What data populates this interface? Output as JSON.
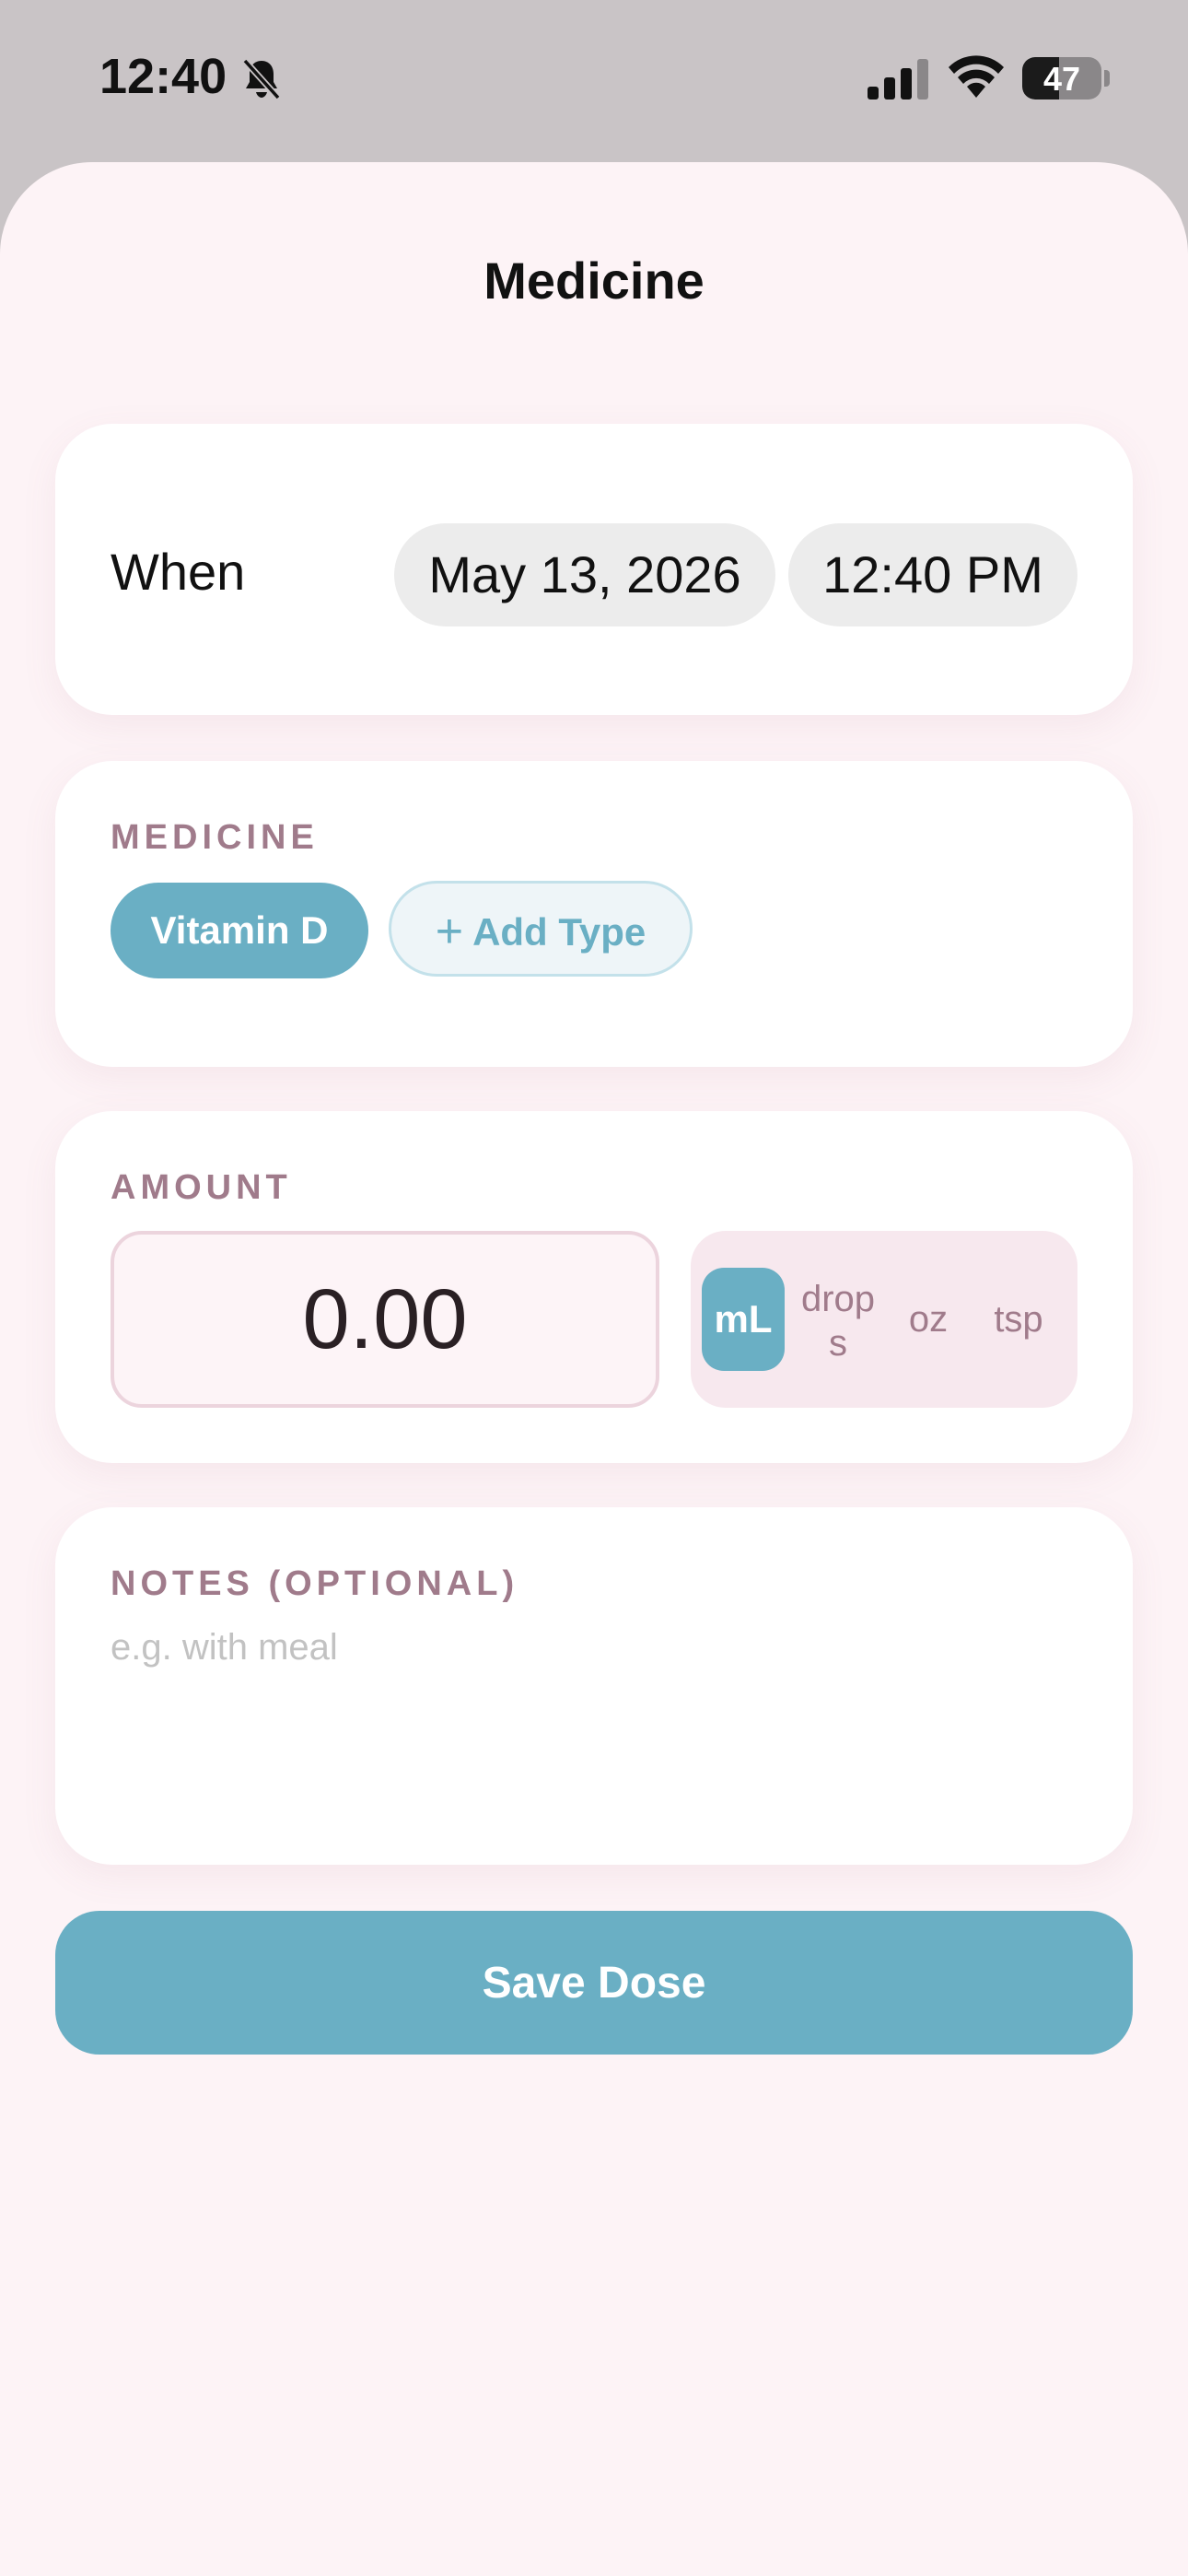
{
  "status_bar": {
    "time": "12:40",
    "battery_percent": "47",
    "battery_level": 0.47,
    "icons": [
      "bell-slash-icon",
      "cellular-signal-icon",
      "wifi-icon",
      "battery-icon"
    ]
  },
  "sheet": {
    "title": "Medicine"
  },
  "when": {
    "label": "When",
    "date": "May 13, 2026",
    "time": "12:40 PM"
  },
  "medicine": {
    "label": "MEDICINE",
    "selected": "Vitamin D",
    "add_label": "Add Type",
    "add_icon": "plus-icon"
  },
  "amount": {
    "label": "AMOUNT",
    "value": "0.00",
    "units": [
      "mL",
      "drops",
      "oz",
      "tsp"
    ],
    "selected_unit": "mL"
  },
  "notes": {
    "label": "NOTES (OPTIONAL)",
    "placeholder": "e.g. with meal"
  },
  "save": {
    "label": "Save Dose"
  },
  "colors": {
    "accent": "#6aafc4",
    "label": "#a07b8b",
    "sheet_background": "#fdf3f6"
  }
}
